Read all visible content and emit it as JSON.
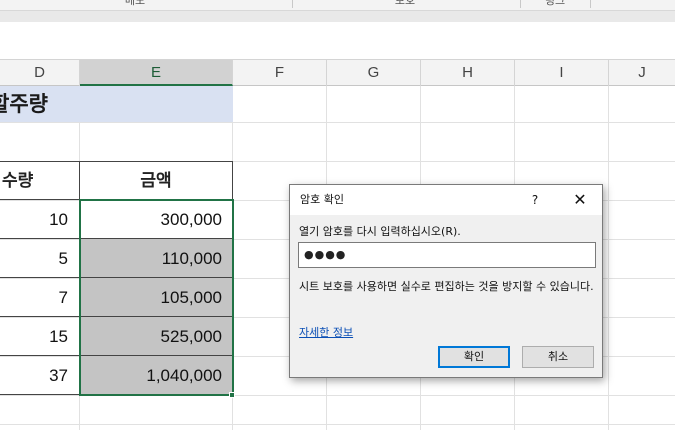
{
  "ribbon": {
    "groups": [
      "메모",
      "보호",
      "링크"
    ]
  },
  "columns": [
    "D",
    "E",
    "F",
    "G",
    "H",
    "I",
    "J"
  ],
  "sheet": {
    "title_fragment": "할주량",
    "headers": {
      "quantity": "수량",
      "amount": "금액"
    },
    "rows": [
      {
        "quantity": "10",
        "amount": "300,000"
      },
      {
        "quantity": "5",
        "amount": "110,000"
      },
      {
        "quantity": "7",
        "amount": "105,000"
      },
      {
        "quantity": "15",
        "amount": "525,000"
      },
      {
        "quantity": "37",
        "amount": "1,040,000"
      }
    ]
  },
  "dialog": {
    "title": "암호 확인",
    "help": "?",
    "close": "✕",
    "prompt": "열기 암호를 다시 입력하십시오(R).",
    "password_value": "●●●●",
    "caution": "시트 보호를 사용하면 실수로 편집하는 것을 방지할 수 있습니다.",
    "link": "자세한 정보",
    "ok": "확인",
    "cancel": "취소"
  },
  "colors": {
    "title_band": "#d9e1f2",
    "selection": "#217346",
    "shade": "#c4c4c4",
    "focus": "#0078d7"
  }
}
